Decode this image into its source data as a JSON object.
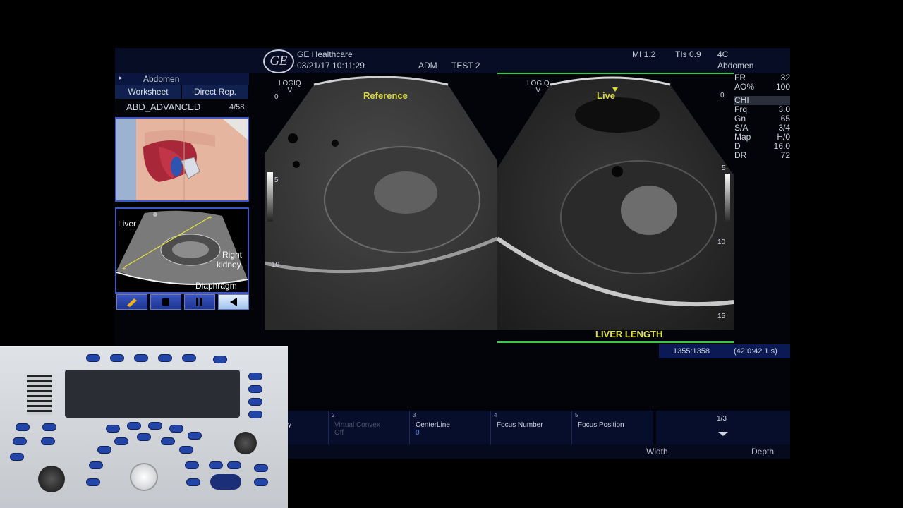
{
  "header": {
    "brand": "GE Healthcare",
    "logo": "GE",
    "datetime": "03/21/17 10:11:29",
    "operator": "ADM",
    "patient": "TEST 2",
    "mi": "MI 1.2",
    "tis": "TIs 0.9",
    "probe": "4C",
    "preset": "Abdomen"
  },
  "left_panel": {
    "category_arrow": "▸",
    "category": "Abdomen",
    "tabs": [
      "Worksheet",
      "Direct Rep."
    ],
    "protocol": "ABD_ADVANCED",
    "protocol_step": "4/58",
    "diagram_labels": {
      "liver": "Liver",
      "right_kidney_1": "Right",
      "right_kidney_2": "kidney",
      "diaphragm": "Diaphragm"
    },
    "controls": [
      "pencil-icon",
      "stop-icon",
      "pause-icon",
      "play-back-icon"
    ]
  },
  "images": {
    "left": {
      "label": "Reference",
      "logiq": "LOGIQ",
      "logiq_sub": "V",
      "depth_top": "0",
      "depth_mid": "5",
      "depth_low": "10"
    },
    "right": {
      "label": "Live",
      "logiq": "LOGIQ",
      "logiq_sub": "V",
      "depth_top": "0",
      "depth_mid": "5",
      "depth_low": "10",
      "depth_bottom": "15",
      "caption": "LIVER LENGTH"
    }
  },
  "params": [
    {
      "k": "FR",
      "v": "32"
    },
    {
      "k": "AO%",
      "v": "100"
    },
    {
      "k": "CHI",
      "v": ""
    },
    {
      "k": "Frq",
      "v": "3.0"
    },
    {
      "k": "Gn",
      "v": "65"
    },
    {
      "k": "S/A",
      "v": "3/4"
    },
    {
      "k": "Map",
      "v": "H/0"
    },
    {
      "k": "D",
      "v": "16.0"
    },
    {
      "k": "DR",
      "v": "72"
    }
  ],
  "status": {
    "frames": "1355:1358",
    "time": "(42.0:42.1 s)"
  },
  "softmenu": {
    "cells": [
      {
        "num": "",
        "label": "y",
        "value": ""
      },
      {
        "num": "2",
        "label": "Virtual Convex",
        "value": "Off"
      },
      {
        "num": "3",
        "label": "CenterLine",
        "value": "0"
      },
      {
        "num": "4",
        "label": "Focus Number",
        "value": ""
      },
      {
        "num": "5",
        "label": "Focus Position",
        "value": ""
      }
    ],
    "page": "1/3",
    "width": "Width",
    "depth": "Depth"
  },
  "colors": {
    "accent_green": "#35c94a",
    "label_yellow": "#d9d93a",
    "panel_blue": "#0a1540"
  }
}
